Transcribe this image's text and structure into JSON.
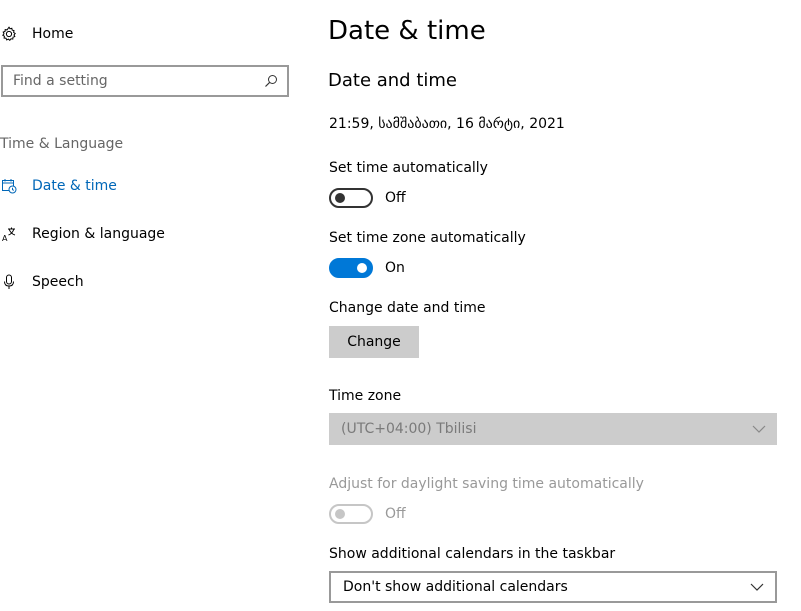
{
  "sidebar": {
    "home_label": "Home",
    "search_placeholder": "Find a setting",
    "section_title": "Time & Language",
    "items": [
      {
        "label": "Date & time",
        "icon": "calendar-clock-icon",
        "active": true
      },
      {
        "label": "Region & language",
        "icon": "language-icon",
        "active": false
      },
      {
        "label": "Speech",
        "icon": "microphone-icon",
        "active": false
      }
    ]
  },
  "main": {
    "page_title": "Date & time",
    "section_title": "Date and time",
    "current_datetime": "21:59, სამშაბათი, 16 მარტი, 2021",
    "set_time_auto": {
      "label": "Set time automatically",
      "state": "Off"
    },
    "set_tz_auto": {
      "label": "Set time zone automatically",
      "state": "On"
    },
    "change_dt": {
      "label": "Change date and time",
      "button": "Change"
    },
    "time_zone": {
      "label": "Time zone",
      "value": "(UTC+04:00) Tbilisi"
    },
    "dst": {
      "label": "Adjust for daylight saving time automatically",
      "state": "Off"
    },
    "calendars": {
      "label": "Show additional calendars in the taskbar",
      "value": "Don't show additional calendars"
    }
  },
  "colors": {
    "accent": "#0078d7",
    "link": "#0067b8",
    "disabled_text": "#999999",
    "disabled_bg": "#cccccc"
  }
}
